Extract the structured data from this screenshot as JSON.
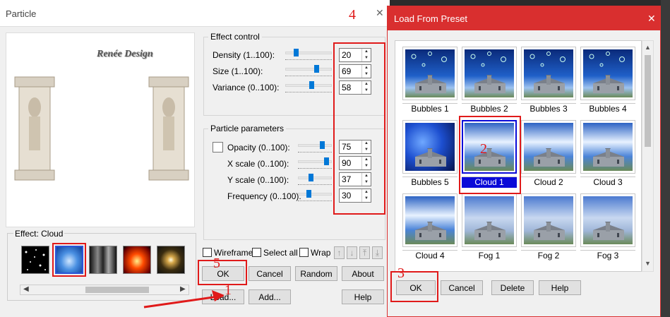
{
  "particle": {
    "title": "Particle",
    "close_glyph": "✕",
    "logo_text": "Renée Design",
    "effect_control": {
      "label": "Effect control",
      "rows": [
        {
          "label": "Density (1..100):",
          "value": "20",
          "level": 0.2
        },
        {
          "label": "Size (1..100):",
          "value": "69",
          "level": 0.69
        },
        {
          "label": "Variance (0..100):",
          "value": "58",
          "level": 0.58
        }
      ]
    },
    "particle_params": {
      "label": "Particle parameters",
      "rows": [
        {
          "label": "Opacity (0..100):",
          "value": "75",
          "level": 0.75
        },
        {
          "label": "X scale (0..100):",
          "value": "90",
          "level": 0.9
        },
        {
          "label": "Y scale (0..100):",
          "value": "37",
          "level": 0.37
        },
        {
          "label": "Frequency (0..100):",
          "value": "30",
          "level": 0.3
        }
      ]
    },
    "effect_label": "Effect: Cloud",
    "checkboxes": {
      "wireframe": "Wireframe",
      "select_all": "Select all",
      "wrap": "Wrap"
    },
    "buttons": {
      "ok": "OK",
      "cancel": "Cancel",
      "random": "Random",
      "about": "About",
      "load": "Load...",
      "add": "Add...",
      "help": "Help"
    }
  },
  "preset": {
    "title": "Load From Preset",
    "close_glyph": "✕",
    "items": [
      "Bubbles 1",
      "Bubbles 2",
      "Bubbles 3",
      "Bubbles 4",
      "Bubbles 5",
      "Cloud 1",
      "Cloud 2",
      "Cloud 3",
      "Cloud 4",
      "Fog 1",
      "Fog 2",
      "Fog 3"
    ],
    "selected": "Cloud 1",
    "buttons": {
      "ok": "OK",
      "cancel": "Cancel",
      "delete": "Delete",
      "help": "Help"
    }
  },
  "annotations": {
    "n1": "1",
    "n2": "2",
    "n3": "3",
    "n4": "4",
    "n5": "5"
  },
  "colors": {
    "accent_red": "#e01a1a",
    "title_red": "#d92f2f",
    "selection_blue": "#0a0ad8",
    "slider_blue": "#0078d7"
  }
}
